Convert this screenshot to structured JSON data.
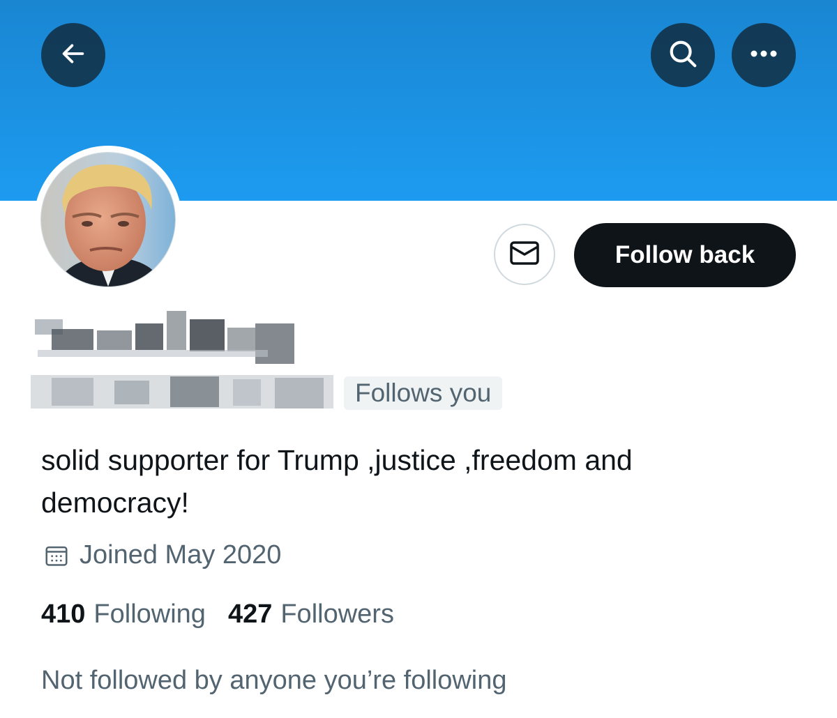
{
  "header": {
    "back_icon": "arrow-left-icon",
    "search_icon": "search-icon",
    "more_icon": "more-horizontal-icon",
    "banner_color": "#1d9bf0"
  },
  "profile": {
    "avatar": "profile-photo",
    "name": "",
    "handle": "",
    "follows_you_label": "Follows you",
    "bio": "solid supporter for Trump ,justice ,freedom and democracy!",
    "joined": "Joined May 2020",
    "following_count": "410",
    "following_label": "Following",
    "followers_count": "427",
    "followers_label": "Followers",
    "mutuals_text": "Not followed by anyone you’re following"
  },
  "actions": {
    "message_icon": "mail-icon",
    "follow_label": "Follow back"
  },
  "colors": {
    "primary_text": "#0f1419",
    "secondary_text": "#536471",
    "button_dark": "#0f1419",
    "badge_bg": "#eff3f4"
  }
}
